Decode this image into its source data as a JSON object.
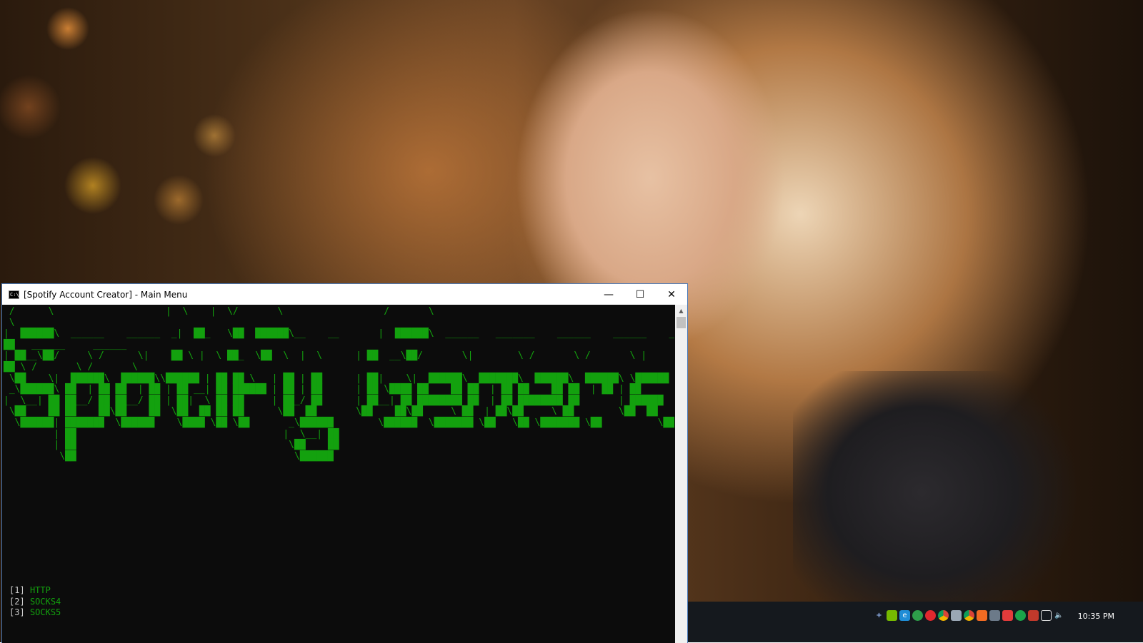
{
  "window": {
    "title": "[Spotify Account Creator] - Main Menu",
    "app_icon_text": "C:\\"
  },
  "console": {
    "ascii_art": " /      \\                    |  \\    |  \\/       \\                  /       \\\n \\\n|  ██████\\  ______    ______  _|  ██_   \\██  ██████\\__    __       |  ██████\\  ______   _______    ______    ______    ______  _|\n██   ______     ______\n| ██__\\██/     \\ /      \\|    ██ \\ |  \\ ██_  \\██  \\  |  \\      | ██  __\\██/       \\|        \\ /       \\ /       \\ |       \\|\n██ \\ /       \\ /       \\\n \\██    \\|  ██████\\  ██████\\\\██████ | ██ ██ \\   | ██ | ██      | ██|    \\|  ██████\\  ███████\\  ██████\\  ██████\\ \\██████\n _\\██████\\ ██  | ██ ██  | ██ | ██ __| ██ ██████ | ██ | ██      | ██ \\████ ██    ██ ██  | ██ ██    ██ ██  | ██ | ██\n|  \\__| ██ ██__/ ██ ██__/ ██ | ██|  \\ ██ ██     | ██_/ ██      | ██__| ██ ████████ ██  | ██ ████████ ██       | ██████\n \\██    ██ ██    ██\\██    ██  \\██  ██ ██ ██      \\██  ██       \\██    ██\\██     \\ ██  | ██\\██     \\ ██        \\██  ██\n  \\██████| ███████  \\██████    \\████ \\██ \\██       _\\██████        \\██████  \\███████ \\██   \\██ \\███████ \\██          \\██████\n         | ██                                     |  \\__| ██\n         | ██                                      \\██    ██\n          \\██                                       \\██████",
    "menu": [
      {
        "num": "1",
        "label": "HTTP"
      },
      {
        "num": "2",
        "label": "SOCKS4"
      },
      {
        "num": "3",
        "label": "SOCKS5"
      }
    ]
  },
  "taskbar": {
    "clock": "10:35 PM",
    "tray_icons": [
      "plus-icon",
      "nvidia-icon",
      "e-icon",
      "recycle-icon",
      "opera-icon",
      "chrome-icon",
      "files-icon",
      "chrome-icon-2",
      "box-icon",
      "network-share-icon",
      "red-app-icon",
      "record-icon",
      "tree-icon",
      "display-icon",
      "volume-icon"
    ]
  },
  "colors": {
    "console_green": "#13a10e",
    "console_bg": "#0c0c0c",
    "taskbar_bg": "#15191e",
    "window_border": "#4a7ab8"
  }
}
